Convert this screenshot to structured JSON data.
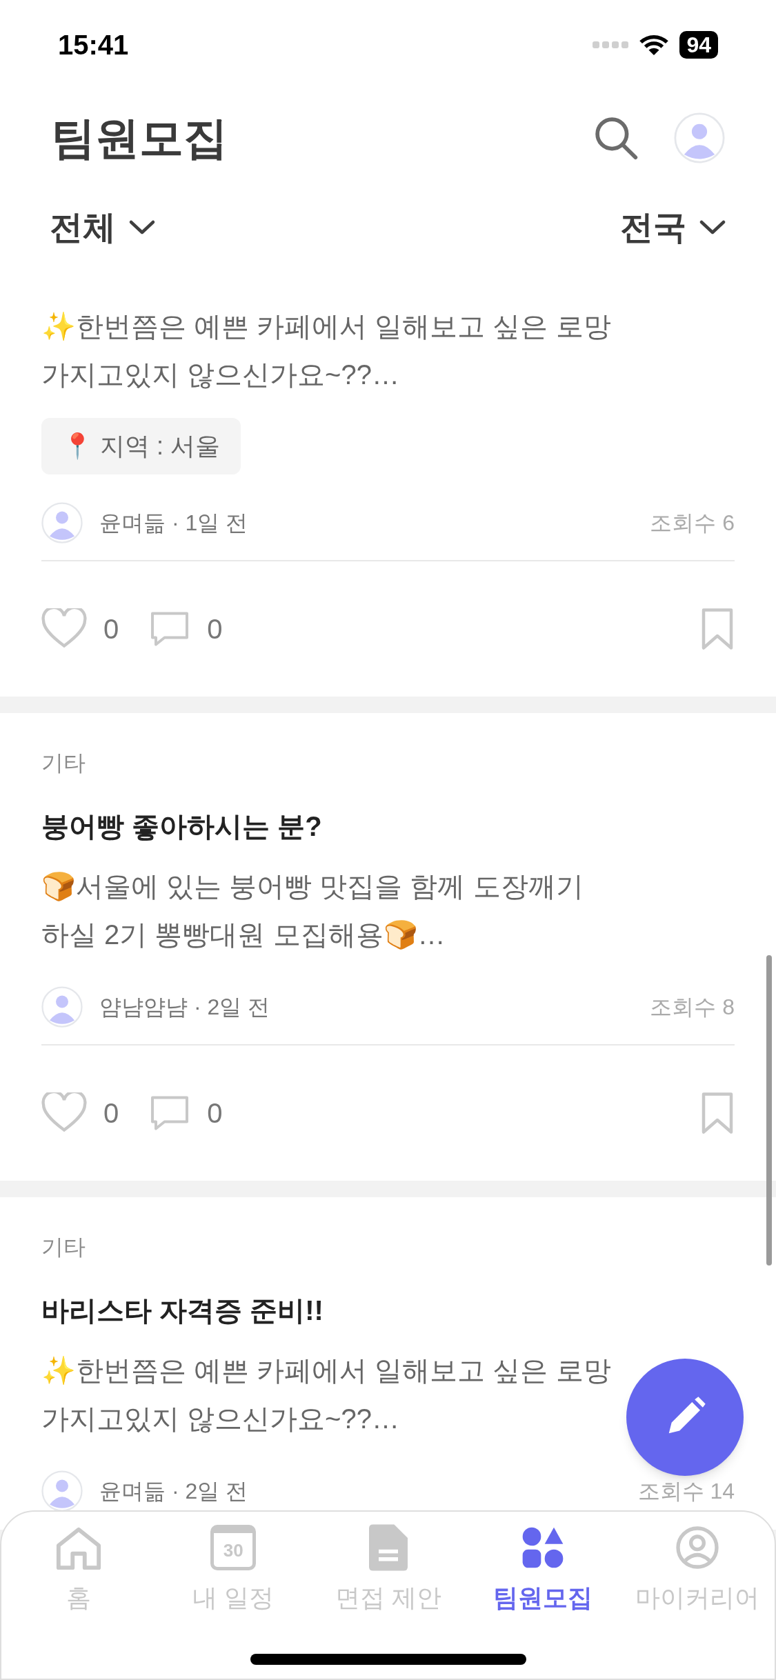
{
  "status_bar": {
    "time": "15:41",
    "battery": "94"
  },
  "header": {
    "title": "팀원모집"
  },
  "filters": [
    {
      "label": "전체"
    },
    {
      "label": "전국"
    }
  ],
  "posts": [
    {
      "body": "✨한번쯤은 예쁜 카페에서 일해보고 싶은 로망 가지고있지 않으신가요~??…",
      "tag": "📍 지역 : 서울",
      "author": "윤며듦 · 1일 전",
      "views": "조회수 6",
      "likes": "0",
      "comments": "0",
      "bookmarked": false
    },
    {
      "category": "기타",
      "title": "붕어빵 좋아하시는 분?",
      "body": "🍞서울에 있는 붕어빵 맛집을 함께 도장깨기 하실 2기 뽕빵대원 모집해용🍞…",
      "author": "얌냠얌냠 · 2일 전",
      "views": "조회수 8",
      "likes": "0",
      "comments": "0",
      "bookmarked": false
    },
    {
      "category": "기타",
      "title": "바리스타 자격증 준비!!",
      "body": "✨한번쯤은 예쁜 카페에서 일해보고 싶은 로망 가지고있지 않으신가요~??…",
      "author": "윤며듦 · 2일 전",
      "views": "조회수 14"
    }
  ],
  "tab_bar": [
    {
      "kind": "home",
      "label": "홈",
      "selected": false
    },
    {
      "kind": "calendar",
      "label": "내 일정",
      "icon_text": "30",
      "selected": false
    },
    {
      "kind": "document",
      "label": "면접 제안",
      "selected": false
    },
    {
      "kind": "shapes",
      "label": "팀원모집",
      "selected": true
    },
    {
      "kind": "profile",
      "label": "마이커리어",
      "selected": false
    }
  ]
}
